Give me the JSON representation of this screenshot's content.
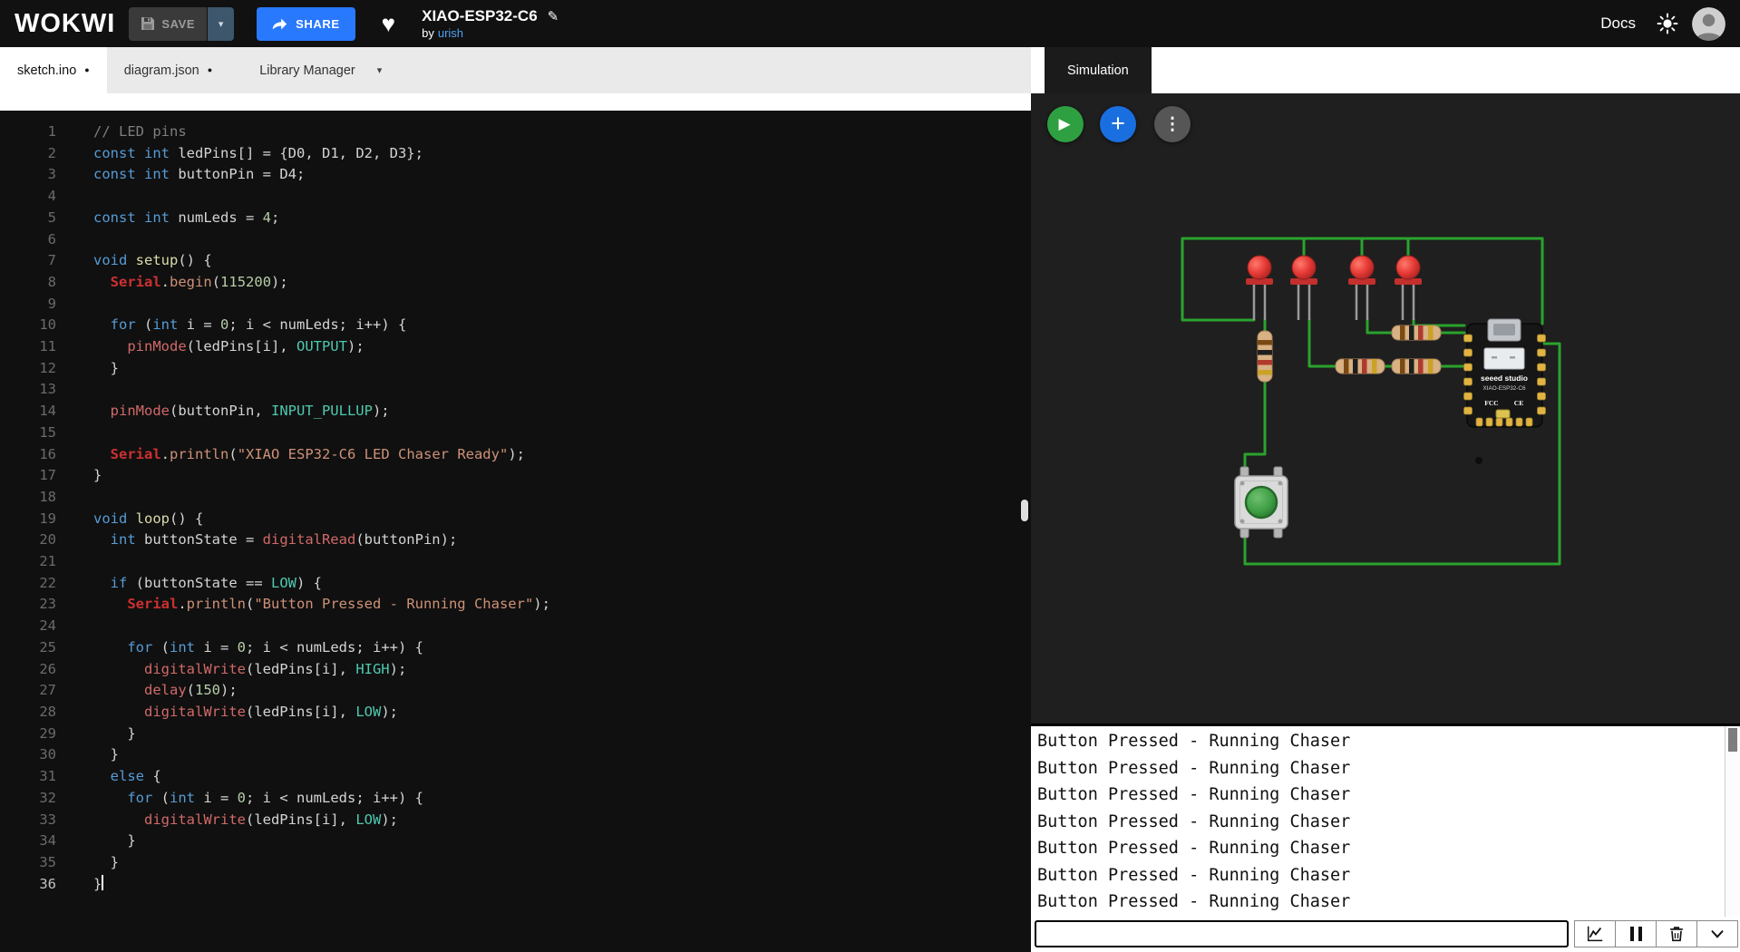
{
  "topbar": {
    "logo": "WOKWI",
    "save_label": "SAVE",
    "share_label": "SHARE",
    "docs_label": "Docs",
    "project": {
      "title": "XIAO-ESP32-C6",
      "by_label": "by",
      "author": "urish"
    }
  },
  "file_tabs": {
    "sketch": "sketch.ino",
    "diagram": "diagram.json",
    "library_manager": "Library Manager"
  },
  "sim": {
    "tab_label": "Simulation",
    "board": {
      "brand": "seeed studio",
      "name": "XIAO-ESP32-C6",
      "fcc_mark": "FCC",
      "ce_mark": "CE"
    },
    "components": [
      {
        "type": "led",
        "color": "red",
        "count": 4
      },
      {
        "type": "resistor",
        "count": 4
      },
      {
        "type": "pushbutton",
        "cap_color": "green",
        "count": 1
      },
      {
        "type": "board",
        "label": "XIAO-ESP32-C6",
        "count": 1
      }
    ],
    "wire_color": "#2aa32e"
  },
  "editor": {
    "active_line": 36,
    "lines": [
      [
        [
          "c",
          "// LED pins"
        ]
      ],
      [
        [
          "k",
          "const"
        ],
        [
          "p",
          " "
        ],
        [
          "k",
          "int"
        ],
        [
          "p",
          " ledPins[] = {D0, D1, D2, D3};"
        ]
      ],
      [
        [
          "k",
          "const"
        ],
        [
          "p",
          " "
        ],
        [
          "k",
          "int"
        ],
        [
          "p",
          " buttonPin = D4;"
        ]
      ],
      [],
      [
        [
          "k",
          "const"
        ],
        [
          "p",
          " "
        ],
        [
          "k",
          "int"
        ],
        [
          "p",
          " numLeds = "
        ],
        [
          "n",
          "4"
        ],
        [
          "p",
          ";"
        ]
      ],
      [],
      [
        [
          "k",
          "void"
        ],
        [
          "p",
          " "
        ],
        [
          "f",
          "setup"
        ],
        [
          "p",
          "() {"
        ]
      ],
      [
        [
          "p",
          "  "
        ],
        [
          "S",
          "Serial"
        ],
        [
          "p",
          "."
        ],
        [
          "M",
          "begin"
        ],
        [
          "p",
          "("
        ],
        [
          "n",
          "115200"
        ],
        [
          "p",
          ");"
        ]
      ],
      [],
      [
        [
          "p",
          "  "
        ],
        [
          "k",
          "for"
        ],
        [
          "p",
          " ("
        ],
        [
          "k",
          "int"
        ],
        [
          "p",
          " i = "
        ],
        [
          "n",
          "0"
        ],
        [
          "p",
          "; i < numLeds; i++) {"
        ]
      ],
      [
        [
          "p",
          "    "
        ],
        [
          "m",
          "pinMode"
        ],
        [
          "p",
          "(ledPins[i], "
        ],
        [
          "o",
          "OUTPUT"
        ],
        [
          "p",
          ");"
        ]
      ],
      [
        [
          "p",
          "  }"
        ]
      ],
      [],
      [
        [
          "p",
          "  "
        ],
        [
          "m",
          "pinMode"
        ],
        [
          "p",
          "(buttonPin, "
        ],
        [
          "o",
          "INPUT_PULLUP"
        ],
        [
          "p",
          ");"
        ]
      ],
      [],
      [
        [
          "p",
          "  "
        ],
        [
          "S",
          "Serial"
        ],
        [
          "p",
          "."
        ],
        [
          "M",
          "println"
        ],
        [
          "p",
          "("
        ],
        [
          "s",
          "\"XIAO ESP32-C6 LED Chaser Ready\""
        ],
        [
          "p",
          ");"
        ]
      ],
      [
        [
          "p",
          "}"
        ]
      ],
      [],
      [
        [
          "k",
          "void"
        ],
        [
          "p",
          " "
        ],
        [
          "f",
          "loop"
        ],
        [
          "p",
          "() {"
        ]
      ],
      [
        [
          "p",
          "  "
        ],
        [
          "k",
          "int"
        ],
        [
          "p",
          " buttonState = "
        ],
        [
          "m",
          "digitalRead"
        ],
        [
          "p",
          "(buttonPin);"
        ]
      ],
      [],
      [
        [
          "p",
          "  "
        ],
        [
          "k",
          "if"
        ],
        [
          "p",
          " (buttonState == "
        ],
        [
          "o",
          "LOW"
        ],
        [
          "p",
          ") {"
        ]
      ],
      [
        [
          "p",
          "    "
        ],
        [
          "S",
          "Serial"
        ],
        [
          "p",
          "."
        ],
        [
          "M",
          "println"
        ],
        [
          "p",
          "("
        ],
        [
          "s",
          "\"Button Pressed - Running Chaser\""
        ],
        [
          "p",
          ");"
        ]
      ],
      [],
      [
        [
          "p",
          "    "
        ],
        [
          "k",
          "for"
        ],
        [
          "p",
          " ("
        ],
        [
          "k",
          "int"
        ],
        [
          "p",
          " i = "
        ],
        [
          "n",
          "0"
        ],
        [
          "p",
          "; i < numLeds; i++) {"
        ]
      ],
      [
        [
          "p",
          "      "
        ],
        [
          "m",
          "digitalWrite"
        ],
        [
          "p",
          "(ledPins[i], "
        ],
        [
          "o",
          "HIGH"
        ],
        [
          "p",
          ");"
        ]
      ],
      [
        [
          "p",
          "      "
        ],
        [
          "m",
          "delay"
        ],
        [
          "p",
          "("
        ],
        [
          "n",
          "150"
        ],
        [
          "p",
          ");"
        ]
      ],
      [
        [
          "p",
          "      "
        ],
        [
          "m",
          "digitalWrite"
        ],
        [
          "p",
          "(ledPins[i], "
        ],
        [
          "o",
          "LOW"
        ],
        [
          "p",
          ");"
        ]
      ],
      [
        [
          "p",
          "    }"
        ]
      ],
      [
        [
          "p",
          "  }"
        ]
      ],
      [
        [
          "p",
          "  "
        ],
        [
          "k",
          "else"
        ],
        [
          "p",
          " {"
        ]
      ],
      [
        [
          "p",
          "    "
        ],
        [
          "k",
          "for"
        ],
        [
          "p",
          " ("
        ],
        [
          "k",
          "int"
        ],
        [
          "p",
          " i = "
        ],
        [
          "n",
          "0"
        ],
        [
          "p",
          "; i < numLeds; i++) {"
        ]
      ],
      [
        [
          "p",
          "      "
        ],
        [
          "m",
          "digitalWrite"
        ],
        [
          "p",
          "(ledPins[i], "
        ],
        [
          "o",
          "LOW"
        ],
        [
          "p",
          ");"
        ]
      ],
      [
        [
          "p",
          "    }"
        ]
      ],
      [
        [
          "p",
          "  }"
        ]
      ],
      [
        [
          "p",
          "}"
        ]
      ]
    ]
  },
  "serial": {
    "lines": [
      "Button Pressed - Running Chaser",
      "Button Pressed - Running Chaser",
      "Button Pressed - Running Chaser",
      "Button Pressed - Running Chaser",
      "Button Pressed - Running Chaser",
      "Button Pressed - Running Chaser",
      "Button Pressed - Running Chaser"
    ],
    "input_value": ""
  },
  "icons": {
    "dirty_dot": "●",
    "dropdown_caret": "▾",
    "heart": "♥",
    "pencil": "✎",
    "play": "▶",
    "plus": "+",
    "menu_dots": "⋮"
  },
  "colors": {
    "accent_blue": "#2979ff",
    "play_green": "#2fa042",
    "wire_green": "#2aa32e",
    "led_red": "#e53935",
    "save_caret_bg": "#3d566b",
    "editor_bg": "#101010",
    "sim_bg": "#1f1f1f"
  }
}
